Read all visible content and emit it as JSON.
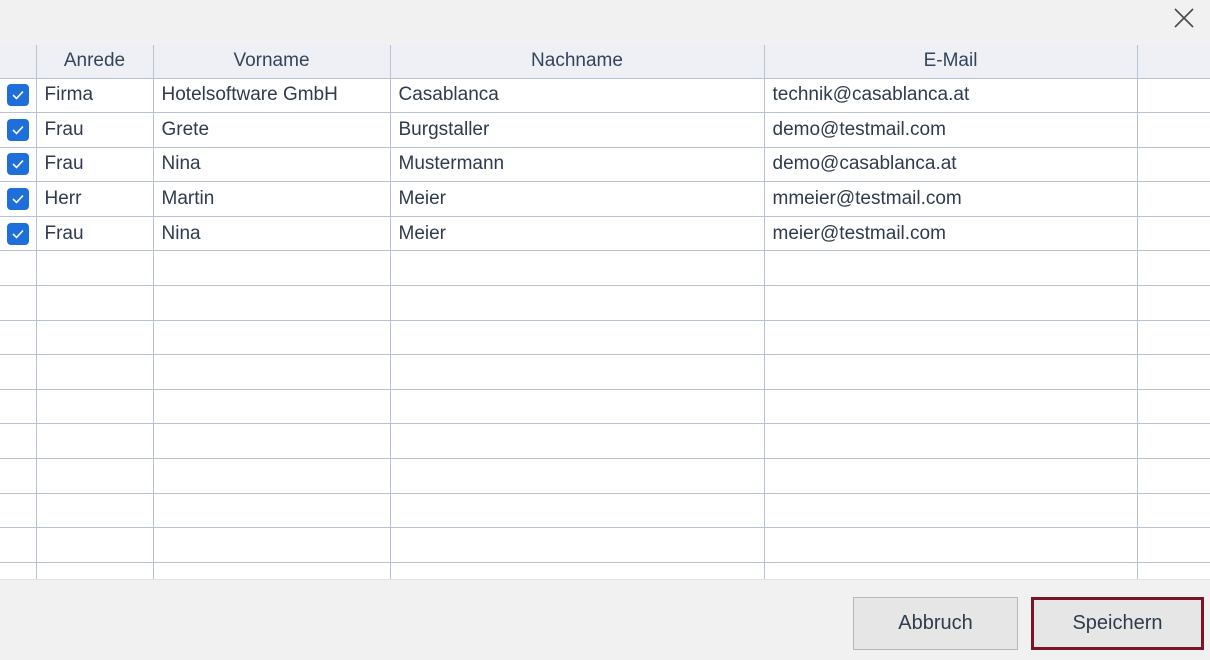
{
  "table": {
    "columns": [
      "",
      "Anrede",
      "Vorname",
      "Nachname",
      "E-Mail",
      ""
    ],
    "rows": [
      {
        "checked": true,
        "anrede": "Firma",
        "vorname": "Hotelsoftware GmbH",
        "nachname": "Casablanca",
        "email": "technik@casablanca.at"
      },
      {
        "checked": true,
        "anrede": "Frau",
        "vorname": "Grete",
        "nachname": "Burgstaller",
        "email": "demo@testmail.com"
      },
      {
        "checked": true,
        "anrede": "Frau",
        "vorname": "Nina",
        "nachname": "Mustermann",
        "email": "demo@casablanca.at"
      },
      {
        "checked": true,
        "anrede": "Herr",
        "vorname": "Martin",
        "nachname": "Meier",
        "email": "mmeier@testmail.com"
      },
      {
        "checked": true,
        "anrede": "Frau",
        "vorname": "Nina",
        "nachname": "Meier",
        "email": "meier@testmail.com"
      }
    ]
  },
  "buttons": {
    "cancel": "Abbruch",
    "save": "Speichern"
  },
  "icons": {
    "close": "close-icon",
    "checkbox": "checkmark-icon"
  },
  "colors": {
    "checkbox": "#1e6fd9",
    "save_border": "#7b1426"
  }
}
